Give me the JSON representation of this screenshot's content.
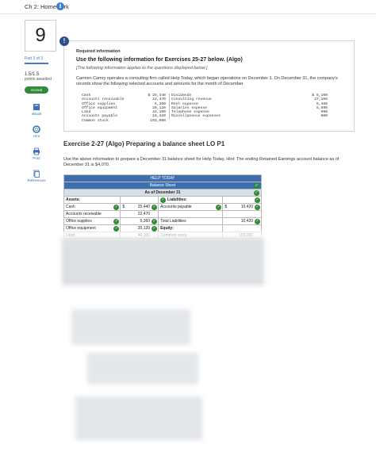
{
  "header": {
    "title": "Ch 2: Homework"
  },
  "sidebar": {
    "question_number": "9",
    "part": "Part 3 of 3",
    "points_value": "1.5/1.5",
    "points_label": "points awarded",
    "scored": "Scored",
    "tools": [
      {
        "label": "eBook",
        "icon": "book-icon"
      },
      {
        "label": "Hint",
        "icon": "lifebuoy-icon"
      },
      {
        "label": "Print",
        "icon": "print-icon"
      },
      {
        "label": "References",
        "icon": "document-icon"
      }
    ]
  },
  "info_card": {
    "required": "Required information",
    "heading": "Use the following information for Exercises 25-27 below. (Algo)",
    "note": "[The following information applies to the questions displayed below.]",
    "paragraph": "Carmen Camry operates a consulting firm called Help Today, which began operations on December 1. On December 31, the company's records show the following selected accounts and amounts for the month of December.",
    "accounts_left": [
      {
        "name": "Cash",
        "amount": "$ 25,440"
      },
      {
        "name": "Accounts receivable",
        "amount": "22,470"
      },
      {
        "name": "Office supplies",
        "amount": "5,360"
      },
      {
        "name": "Office equipment",
        "amount": "20,120"
      },
      {
        "name": "Land",
        "amount": "44,100"
      },
      {
        "name": "Accounts payable",
        "amount": "10,420"
      },
      {
        "name": "Common stock",
        "amount": "103,000"
      }
    ],
    "accounts_right": [
      {
        "name": "Dividends",
        "amount": "$ 6,100"
      },
      {
        "name": "Consulting revenue",
        "amount": "27,100"
      },
      {
        "name": "Rent expense",
        "amount": "9,460"
      },
      {
        "name": "Salaries expense",
        "amount": "5,690"
      },
      {
        "name": "Telephone expense",
        "amount": "980"
      },
      {
        "name": "Miscellaneous expenses",
        "amount": "600"
      }
    ]
  },
  "exercise": {
    "title": "Exercise 2-27 (Algo) Preparing a balance sheet LO P1",
    "instructions": "Use the above information to prepare a December 31 balance sheet for Help Today. Hint: The ending Retained Earnings account balance as of December 31 is $4,070."
  },
  "balance_sheet": {
    "company": "HELP TODAY",
    "statement": "Balance Sheet",
    "date": "As of December 31",
    "assets_label": "Assets:",
    "liabilities_label": "Liabilities:",
    "rows": [
      {
        "asset": "Cash",
        "cur": "$",
        "asset_amt": "25,440",
        "liab": "Accounts payable",
        "lcur": "$",
        "liab_amt": "10,420"
      },
      {
        "asset": "Accounts receivable",
        "cur": "",
        "asset_amt": "22,470",
        "liab": "",
        "lcur": "",
        "liab_amt": ""
      },
      {
        "asset": "Office supplies",
        "cur": "",
        "asset_amt": "5,360",
        "liab": "Total Liabilities",
        "lcur": "",
        "liab_amt": "10,420"
      },
      {
        "asset": "Office equipment",
        "cur": "",
        "asset_amt": "20,120",
        "liab": "Equity:",
        "lcur": "",
        "liab_amt": ""
      },
      {
        "asset": "Land",
        "cur": "",
        "asset_amt": "44,100",
        "liab": "Common stock",
        "lcur": "",
        "liab_amt": "103,000"
      }
    ]
  },
  "colors": {
    "accent": "#3a7bd5",
    "success": "#2e8b3a",
    "table_header": "#3d6fb0"
  }
}
